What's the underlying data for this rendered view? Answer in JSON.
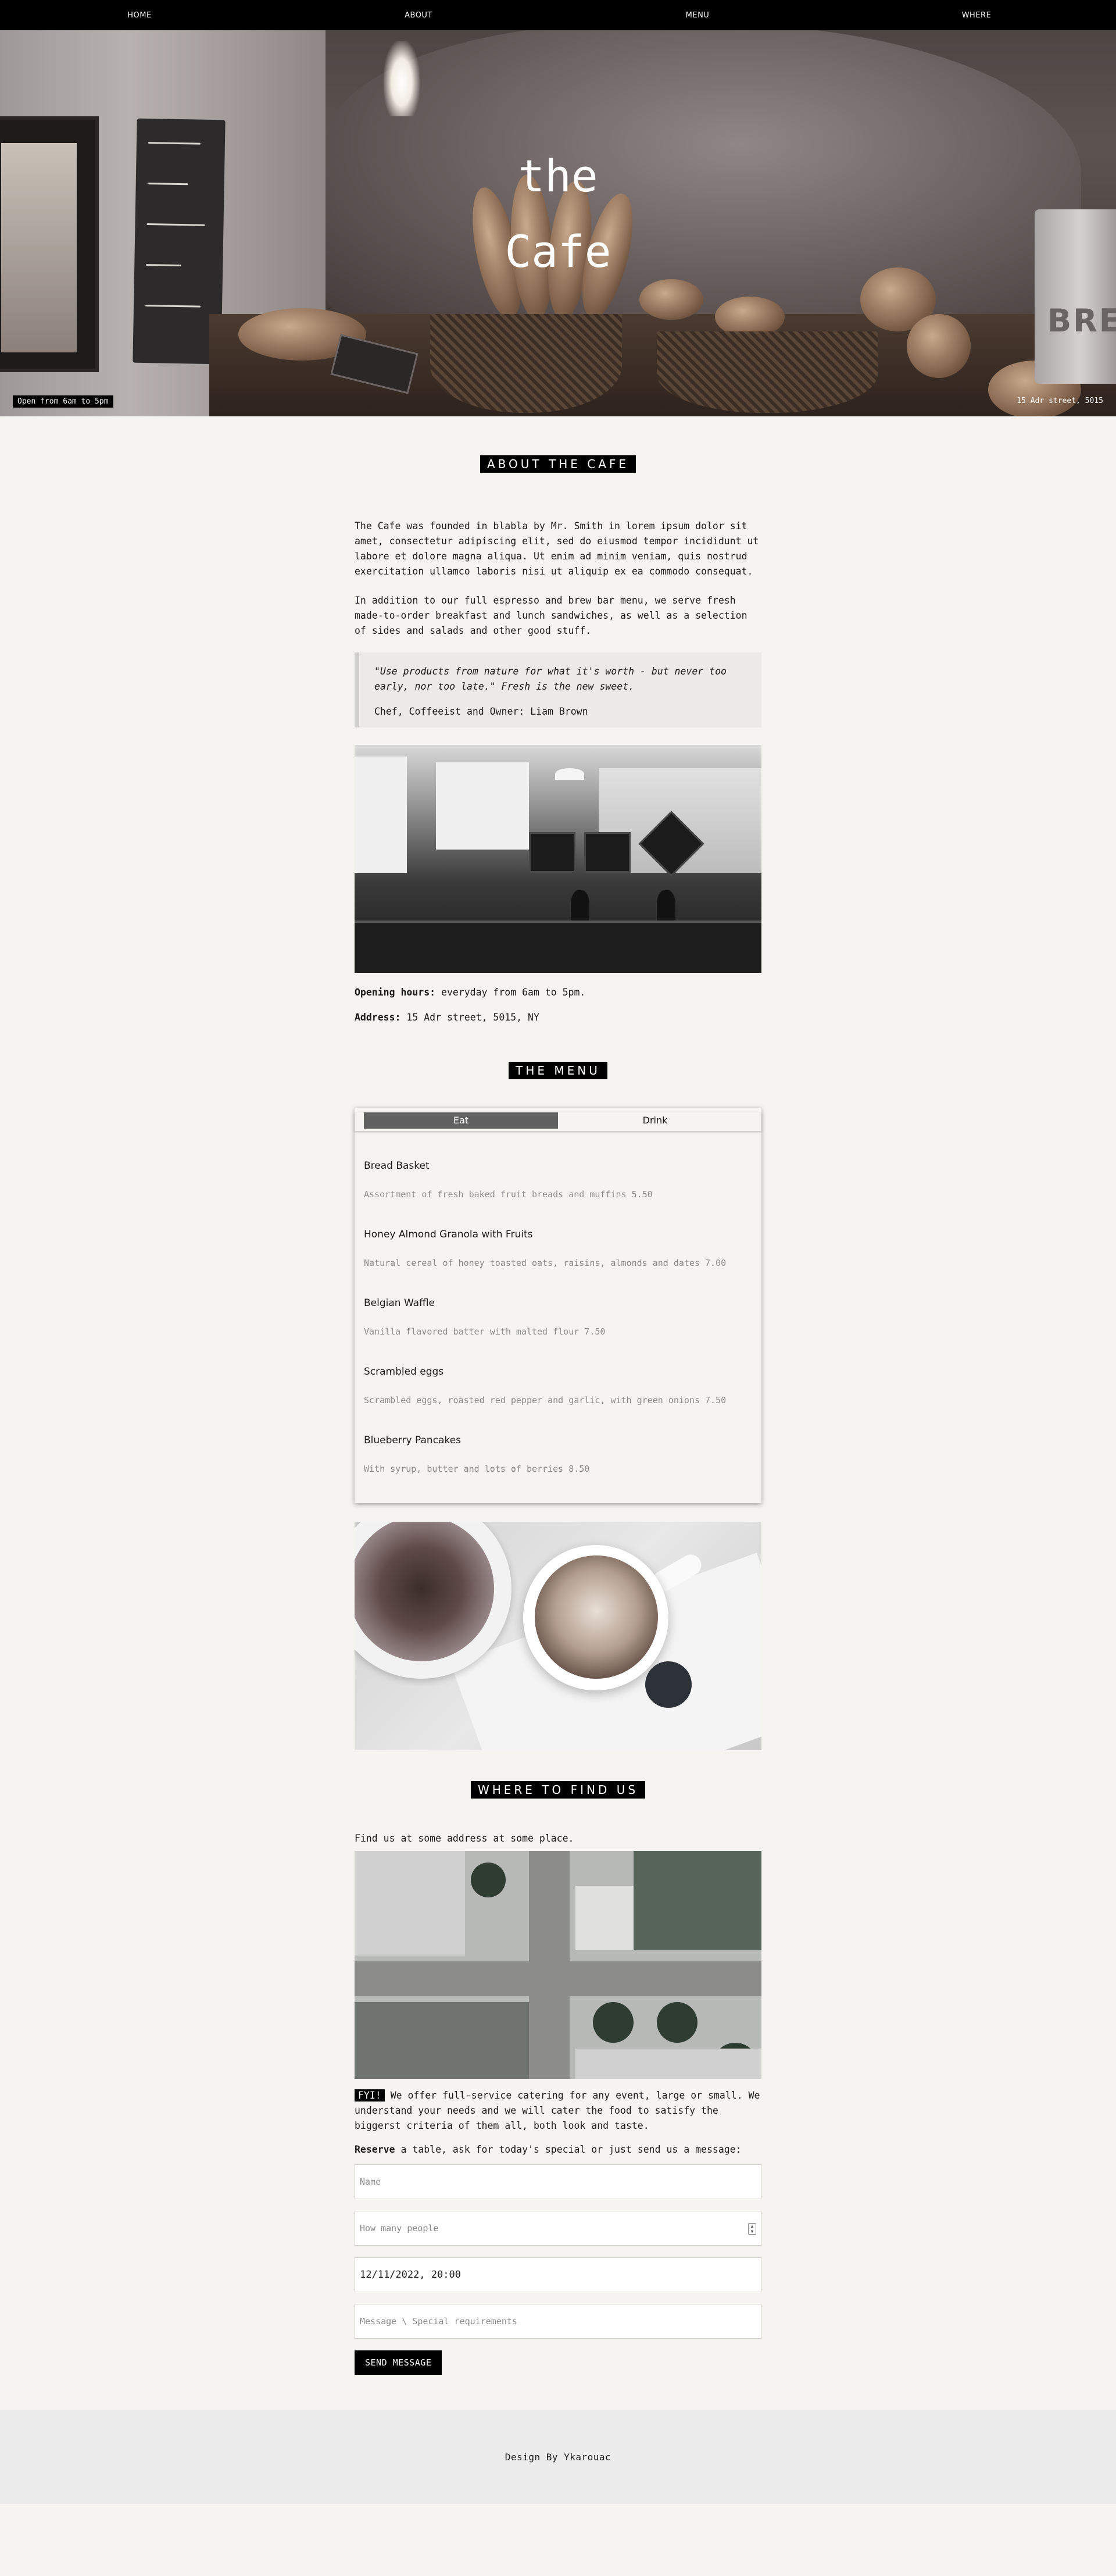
{
  "nav": {
    "items": [
      "HOME",
      "ABOUT",
      "MENU",
      "WHERE"
    ]
  },
  "hero": {
    "title_line1": "the",
    "title_line2": "Cafe",
    "hours_tag": "Open from 6am to 5pm",
    "address_tag": "15 Adr street, 5015"
  },
  "about": {
    "heading": "ABOUT THE CAFE",
    "paragraph1": "The Cafe was founded in blabla by Mr. Smith in lorem ipsum dolor sit amet, consectetur adipiscing elit, sed do eiusmod tempor incididunt ut labore et dolore magna aliqua. Ut enim ad minim veniam, quis nostrud exercitation ullamco laboris nisi ut aliquip ex ea commodo consequat.",
    "paragraph2": "In addition to our full espresso and brew bar menu, we serve fresh made-to-order breakfast and lunch sandwiches, as well as a selection of sides and salads and other good stuff.",
    "quote": "\"Use products from nature for what it's worth - but never too early, nor too late.\" Fresh is the new sweet.",
    "quote_author": "Chef, Coffeeist and Owner: Liam Brown",
    "hours_label": "Opening hours:",
    "hours_value": "everyday from 6am to 5pm.",
    "address_label": "Address:",
    "address_value": "15 Adr street, 5015, NY"
  },
  "menu": {
    "heading": "THE MENU",
    "tabs": [
      "Eat",
      "Drink"
    ],
    "active_tab": "Eat",
    "items": [
      {
        "name": "Bread Basket",
        "desc": "Assortment of fresh baked fruit breads and muffins 5.50"
      },
      {
        "name": "Honey Almond Granola with Fruits",
        "desc": "Natural cereal of honey toasted oats, raisins, almonds and dates 7.00"
      },
      {
        "name": "Belgian Waffle",
        "desc": "Vanilla flavored batter with malted flour 7.50"
      },
      {
        "name": "Scrambled eggs",
        "desc": "Scrambled eggs, roasted red pepper and garlic, with green onions 7.50"
      },
      {
        "name": "Blueberry Pancakes",
        "desc": "With syrup, butter and lots of berries 8.50"
      }
    ]
  },
  "where": {
    "heading": "WHERE TO FIND US",
    "intro": "Find us at some address at some place.",
    "fyi_badge": "FYI!",
    "fyi_text": "We offer full-service catering for any event, large or small. We understand your needs and we will cater the food to satisfy the biggerst criteria of them all, both look and taste.",
    "reserve_label": "Reserve",
    "reserve_text": "a table, ask for today's special or just send us a message:",
    "name_placeholder": "Name",
    "people_placeholder": "How many people",
    "datetime_value": "12/11/2022, 20:00",
    "message_placeholder": "Message \\ Special requirements",
    "send_label": "SEND MESSAGE"
  },
  "footer": {
    "credit": "Design By Ykarouac"
  }
}
